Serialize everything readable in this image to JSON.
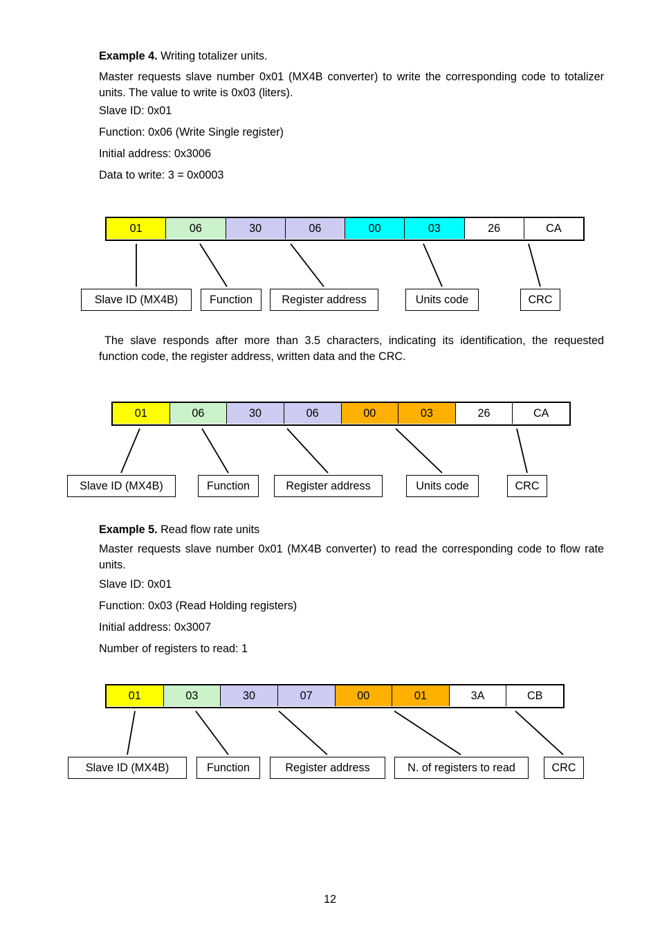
{
  "document": {
    "page_number": "12"
  },
  "colors": {
    "slave_id": "#ffff00",
    "function": "#ccf2cc",
    "register_address": "#ccccf2",
    "data_cyan": "#00ffff",
    "data_orange": "#ffb000",
    "crc": "#ffffff",
    "border": "#000000"
  },
  "example4": {
    "heading_bold": "Example 4.",
    "heading_rest": " Writing totalizer units.",
    "description": "Master requests slave number 0x01 (MX4B converter) to write the corresponding code to totalizer units. The value to write is 0x03 (liters).",
    "lines": [
      "Slave ID: 0x01",
      "Function: 0x06 (Write Single register)",
      "Initial address: 0x3006",
      "Data to write: 3 = 0x0003"
    ]
  },
  "frame1": {
    "cells": [
      {
        "value": "01",
        "color": "#ffff00"
      },
      {
        "value": "06",
        "color": "#ccf2cc"
      },
      {
        "value": "30",
        "color": "#ccccf2"
      },
      {
        "value": "06",
        "color": "#ccccf2"
      },
      {
        "value": "00",
        "color": "#00ffff"
      },
      {
        "value": "03",
        "color": "#00ffff"
      },
      {
        "value": "26",
        "color": "#ffffff"
      },
      {
        "value": "CA",
        "color": "#ffffff"
      }
    ],
    "labels": [
      "Slave ID (MX4B)",
      "Function",
      "Register address",
      "Units code",
      "CRC"
    ]
  },
  "response_paragraph": "The slave responds after more than 3.5 characters, indicating its identification, the requested function code, the register address, written data and the CRC.",
  "frame2": {
    "cells": [
      {
        "value": "01",
        "color": "#ffff00"
      },
      {
        "value": "06",
        "color": "#ccf2cc"
      },
      {
        "value": "30",
        "color": "#ccccf2"
      },
      {
        "value": "06",
        "color": "#ccccf2"
      },
      {
        "value": "00",
        "color": "#ffb000"
      },
      {
        "value": "03",
        "color": "#ffb000"
      },
      {
        "value": "26",
        "color": "#ffffff"
      },
      {
        "value": "CA",
        "color": "#ffffff"
      }
    ],
    "labels": [
      "Slave ID (MX4B)",
      "Function",
      "Register address",
      "Units code",
      "CRC"
    ]
  },
  "example5": {
    "heading_bold": "Example 5.",
    "heading_rest": " Read flow rate units",
    "description": "Master requests slave number 0x01 (MX4B converter) to read the corresponding code to flow rate units.",
    "lines": [
      "Slave ID: 0x01",
      "Function: 0x03 (Read Holding registers)",
      "Initial address: 0x3007",
      "Number of registers to read: 1"
    ]
  },
  "frame3": {
    "cells": [
      {
        "value": "01",
        "color": "#ffff00"
      },
      {
        "value": "03",
        "color": "#ccf2cc"
      },
      {
        "value": "30",
        "color": "#ccccf2"
      },
      {
        "value": "07",
        "color": "#ccccf2"
      },
      {
        "value": "00",
        "color": "#ffb000"
      },
      {
        "value": "01",
        "color": "#ffb000"
      },
      {
        "value": "3A",
        "color": "#ffffff"
      },
      {
        "value": "CB",
        "color": "#ffffff"
      }
    ],
    "labels": [
      "Slave ID (MX4B)",
      "Function",
      "Register address",
      "N. of registers to read",
      "CRC"
    ]
  }
}
